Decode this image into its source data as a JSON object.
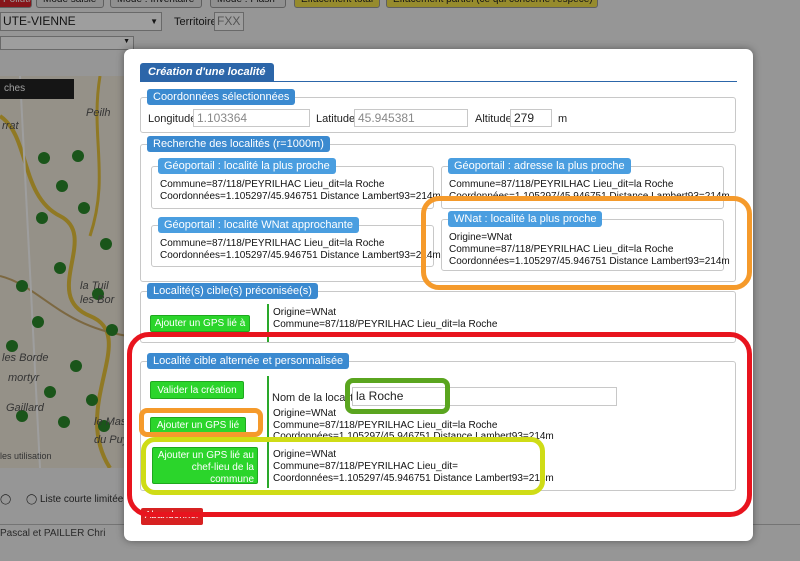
{
  "background": {
    "top_buttons": [
      "Pollution",
      "Mode saisie",
      "Mode : Inventaire",
      "Mode : Flash",
      "Effacement total",
      "Effacement partiel (ce qui concerne l'espèce)"
    ],
    "department_select": "UTE-VIENNE",
    "territory_label": "Territoire",
    "territory_value": "FXX",
    "map_tab": "ches",
    "map_labels": [
      "Peilh",
      "rrat",
      "la Tuil",
      "les Bor",
      "les Borde",
      "mortyr",
      "Gaillard",
      "le Mas",
      "du Puy"
    ],
    "map_credit": "les utilisation",
    "radio_label": "Liste courte limitée au",
    "footer_text": "Pascal et PAILLER Chri"
  },
  "modal": {
    "tab_title": "Création d'une localité",
    "coords": {
      "legend": "Coordonnées sélectionnées",
      "longitude_label": "Longitude",
      "longitude_value": "1.103364",
      "latitude_label": "Latitude",
      "latitude_value": "45.945381",
      "altitude_label": "Altitude",
      "altitude_value": "279",
      "altitude_unit": "m"
    },
    "search": {
      "legend": "Recherche des localités (r=1000m)",
      "geoportail_nearest": {
        "legend": "Géoportail : localité la plus proche",
        "line1": "Commune=87/118/PEYRILHAC  Lieu_dit=la Roche",
        "line2": "Coordonnées=1.105297/45.946751  Distance Lambert93=214m"
      },
      "geoportail_address": {
        "legend": "Géoportail : adresse la plus proche",
        "line1": "Commune=87/118/PEYRILHAC  Lieu_dit=la Roche",
        "line2": "Coordonnées=1.105297/45.946751  Distance Lambert93=214m"
      },
      "geoportail_wnat": {
        "legend": "Géoportail : localité WNat approchante",
        "line1": "Commune=87/118/PEYRILHAC  Lieu_dit=la Roche",
        "line2": "Coordonnées=1.105297/45.946751  Distance Lambert93=214m"
      },
      "wnat_nearest": {
        "legend": "WNat : localité la plus proche",
        "line1": "Origine=WNat",
        "line2": "Commune=87/118/PEYRILHAC  Lieu_dit=la Roche",
        "line3": "Coordonnées=1.105297/45.946751  Distance Lambert93=214m"
      }
    },
    "preconised": {
      "legend": "Localité(s) cible(s) préconisée(s)",
      "button": "Ajouter un GPS lié à",
      "line1": "Origine=WNat",
      "line2": "Commune=87/118/PEYRILHAC  Lieu_dit=la Roche"
    },
    "alternate": {
      "legend": "Localité cible alternée et personnalisée",
      "validate_button": "Valider la création",
      "name_label": "Nom de la localité",
      "name_value": "la Roche",
      "gps_button": "Ajouter un GPS lié à",
      "gps_line1": "Origine=WNat",
      "gps_line2": "Commune=87/118/PEYRILHAC  Lieu_dit=la Roche",
      "gps_line3": "Coordonnées=1.105297/45.946751  Distance Lambert93=214m",
      "chef_button": "Ajouter un GPS lié au chef-lieu de la commune",
      "chef_line1": "Origine=WNat",
      "chef_line2": "Commune=87/118/PEYRILHAC  Lieu_dit=",
      "chef_line3": "Coordonnées=1.105297/45.946751  Distance Lambert93=214m"
    },
    "cancel_button": "Abandonner"
  },
  "annotation_colors": {
    "orange": "#f59a2b",
    "red": "#e8141e",
    "green": "#5aa51f",
    "yellow": "#cfdc16"
  }
}
